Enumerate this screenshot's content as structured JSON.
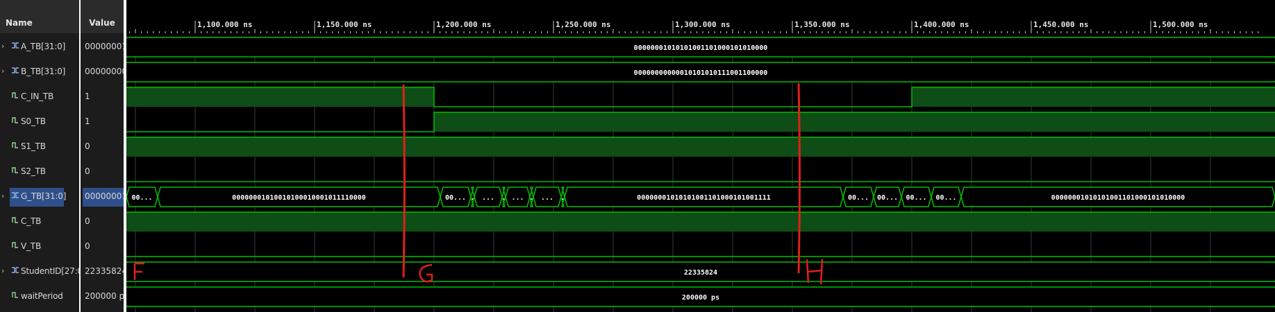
{
  "header": {
    "name_col": "Name",
    "value_col": "Value"
  },
  "signals": [
    {
      "name": "A_TB[31:0]",
      "value": "00000001",
      "kind": "bus",
      "expand": true
    },
    {
      "name": "B_TB[31:0]",
      "value": "00000000",
      "kind": "bus",
      "expand": true
    },
    {
      "name": "C_IN_TB",
      "value": "1",
      "kind": "bit"
    },
    {
      "name": "S0_TB",
      "value": "1",
      "kind": "bit"
    },
    {
      "name": "S1_TB",
      "value": "0",
      "kind": "bit"
    },
    {
      "name": "S2_TB",
      "value": "0",
      "kind": "bit"
    },
    {
      "name": "G_TB[31:0]",
      "value": "00000001",
      "kind": "bus",
      "expand": true,
      "selected": true
    },
    {
      "name": "C_TB",
      "value": "0",
      "kind": "bit"
    },
    {
      "name": "V_TB",
      "value": "0",
      "kind": "bit"
    },
    {
      "name": "StudentID[27:0]",
      "value": "22335824",
      "kind": "bus",
      "expand": true
    },
    {
      "name": "waitPeriod",
      "value": "200000 ps",
      "kind": "const"
    }
  ],
  "ruler": {
    "ticks": [
      "1,100.000 ns",
      "1,150.000 ns",
      "1,200.000 ns",
      "1,250.000 ns",
      "1,300.000 ns",
      "1,350.000 ns",
      "1,400.000 ns",
      "1,450.000 ns",
      "1,500.000 ns"
    ]
  },
  "waves": {
    "A_TB": "00000001010101001101000101010000",
    "B_TB": "00000000000010101010111001100000",
    "G_TB_segments": [
      "00...",
      "00000001010010100010001011110000",
      "00...",
      ".",
      "...",
      ".",
      "...",
      ".",
      "...",
      ".",
      "00000001010101001101000101001111",
      "00...",
      "00...",
      "00...",
      "00...",
      "00000001010101001101000101010000"
    ],
    "StudentID": "22335824",
    "waitPeriod": "200000 ps"
  },
  "annotations": {
    "marker_f": "F",
    "marker_g": "G",
    "marker_h": "H"
  },
  "colors": {
    "wave_green": "#00c000",
    "fill_green": "#0f4d16",
    "grid": "#3a3a3a",
    "annotation_red": "#e0201a"
  }
}
